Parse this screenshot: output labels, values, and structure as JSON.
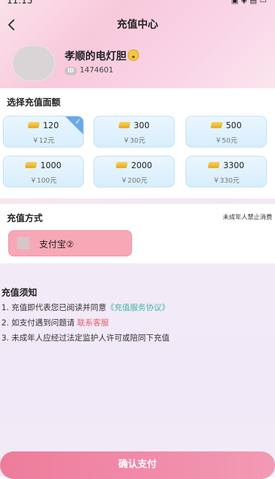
{
  "status_bar": {
    "time": "11:13"
  },
  "header": {
    "title": "充值中心"
  },
  "user": {
    "name": "孝顺的电灯胆",
    "id_badge": "ID",
    "uid": "1474601"
  },
  "amount_section": {
    "label": "选择充值面额",
    "options": [
      {
        "coins": "120",
        "price": "￥12元",
        "selected": true
      },
      {
        "coins": "300",
        "price": "￥30元",
        "selected": false
      },
      {
        "coins": "500",
        "price": "￥50元",
        "selected": false
      },
      {
        "coins": "1000",
        "price": "￥100元",
        "selected": false
      },
      {
        "coins": "2000",
        "price": "￥200元",
        "selected": false
      },
      {
        "coins": "3300",
        "price": "￥330元",
        "selected": false
      }
    ]
  },
  "pay_section": {
    "label": "充值方式",
    "minor_note": "未成年人禁止消费",
    "method": "支付宝②"
  },
  "notice": {
    "title": "充值须知",
    "line1_prefix": "1. 充值即代表您已阅读并同意",
    "line1_link": "《充值服务协议》",
    "line2_prefix": "2. 如支付遇到问题请",
    "line2_link": "联系客服",
    "line3": "3. 未成年人应经过法定监护人许可或陪同下充值"
  },
  "confirm_button": {
    "label": "确认支付"
  },
  "colors": {
    "accent_pink": "#f08aa8",
    "card_blue": "#d7eefc",
    "link_green": "#3fb6a6",
    "link_red": "#e85a6a"
  }
}
